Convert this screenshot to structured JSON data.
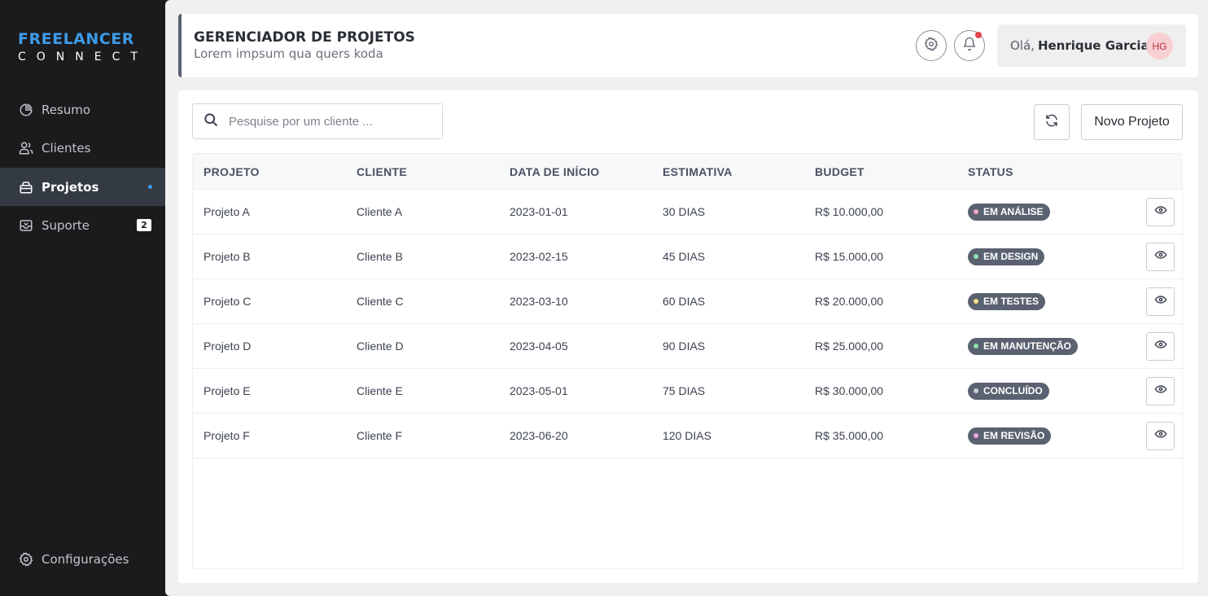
{
  "brand": {
    "line1": "FREELANCER",
    "line2": "CONNECT"
  },
  "sidebar": {
    "items": [
      {
        "label": "Resumo",
        "icon": "pie-chart-icon"
      },
      {
        "label": "Clientes",
        "icon": "users-icon"
      },
      {
        "label": "Projetos",
        "icon": "briefcase-icon",
        "active": true
      },
      {
        "label": "Suporte",
        "icon": "support-inbox-icon",
        "badge": "2"
      }
    ],
    "footer": {
      "label": "Configurações",
      "icon": "gear-icon"
    }
  },
  "header": {
    "title": "GERENCIADOR DE PROJETOS",
    "subtitle": "Lorem impsum qua quers koda",
    "greeting": "Olá,",
    "user_name": "Henrique Garcia",
    "avatar_initials": "HG"
  },
  "toolbar": {
    "search_placeholder": "Pesquise por um cliente ...",
    "new_project_label": "Novo Projeto"
  },
  "table": {
    "columns": [
      "PROJETO",
      "CLIENTE",
      "DATA DE INÍCIO",
      "ESTIMATIVA",
      "BUDGET",
      "STATUS"
    ],
    "rows": [
      {
        "projeto": "Projeto A",
        "cliente": "Cliente A",
        "data": "2023-01-01",
        "estimativa": "30 DIAS",
        "budget": "R$ 10.000,00",
        "status": "EM ANÁLISE",
        "status_color": "#f4a6c0"
      },
      {
        "projeto": "Projeto B",
        "cliente": "Cliente B",
        "data": "2023-02-15",
        "estimativa": "45 DIAS",
        "budget": "R$ 15.000,00",
        "status": "EM DESIGN",
        "status_color": "#8fe3b0"
      },
      {
        "projeto": "Projeto C",
        "cliente": "Cliente C",
        "data": "2023-03-10",
        "estimativa": "60 DIAS",
        "budget": "R$ 20.000,00",
        "status": "EM TESTES",
        "status_color": "#f7e27a"
      },
      {
        "projeto": "Projeto D",
        "cliente": "Cliente D",
        "data": "2023-04-05",
        "estimativa": "90 DIAS",
        "budget": "R$ 25.000,00",
        "status": "EM MANUTENÇÃO",
        "status_color": "#8fe3b0"
      },
      {
        "projeto": "Projeto E",
        "cliente": "Cliente E",
        "data": "2023-05-01",
        "estimativa": "75 DIAS",
        "budget": "R$ 30.000,00",
        "status": "CONCLUÍDO",
        "status_color": "#c9ccd2"
      },
      {
        "projeto": "Projeto F",
        "cliente": "Cliente F",
        "data": "2023-06-20",
        "estimativa": "120 DIAS",
        "budget": "R$ 35.000,00",
        "status": "EM REVISÃO",
        "status_color": "#f2a7e4"
      }
    ]
  },
  "colors": {
    "brand_blue": "#3d9be9",
    "sidebar_bg": "#1b1b1d",
    "active_item_bg": "#343a44",
    "notification_red": "#e2454d"
  }
}
